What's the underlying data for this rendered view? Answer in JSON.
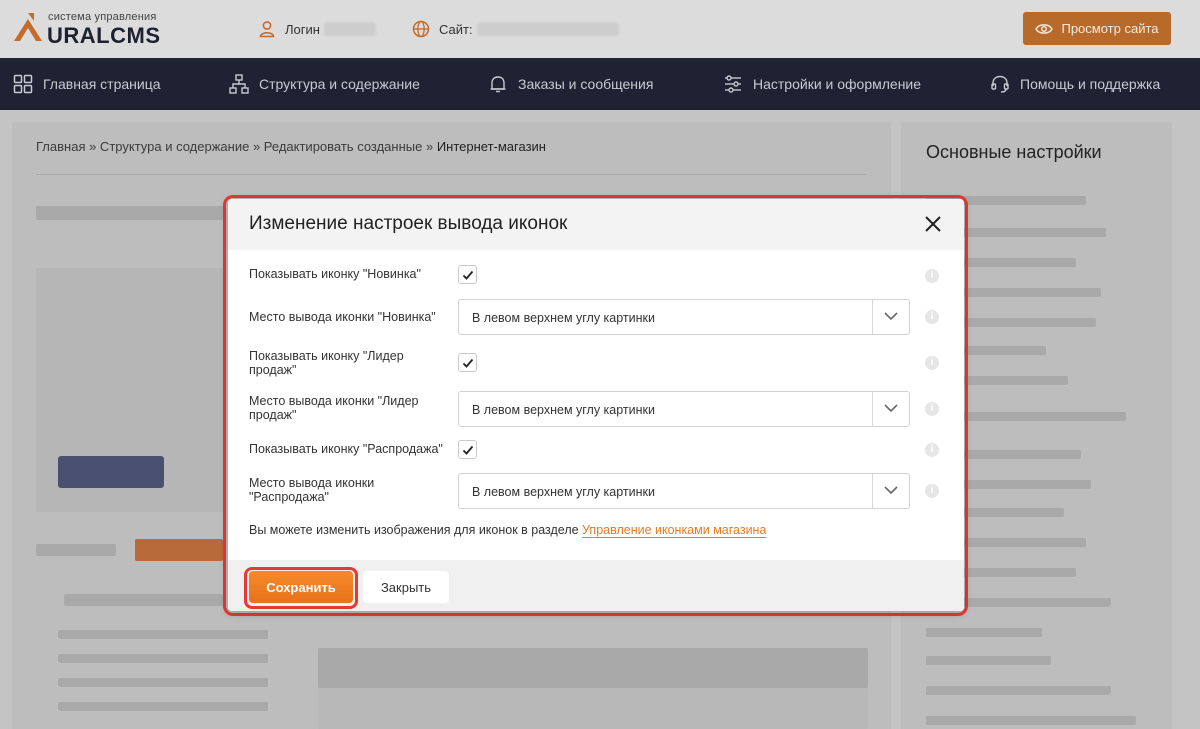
{
  "header": {
    "logo_sub": "система управления",
    "logo_name": "URALCMS",
    "login_label": "Логин",
    "site_label": "Сайт:",
    "view_site": "Просмотр сайта"
  },
  "nav": {
    "items": [
      {
        "label": "Главная страница",
        "icon": "grid-icon"
      },
      {
        "label": "Структура и содержание",
        "icon": "sitemap-icon"
      },
      {
        "label": "Заказы и сообщения",
        "icon": "bell-icon"
      },
      {
        "label": "Настройки и оформление",
        "icon": "sliders-icon"
      },
      {
        "label": "Помощь и поддержка",
        "icon": "headset-icon"
      }
    ]
  },
  "page": {
    "breadcrumb": "Главная » Структура и содержание » Редактировать созданные » ",
    "breadcrumb_current": "Интернет-магазин",
    "side_title": "Основные настройки"
  },
  "modal": {
    "title": "Изменение настроек вывода иконок",
    "rows": [
      {
        "label": "Показывать иконку \"Новинка\"",
        "checked": true
      },
      {
        "label": "Место вывода иконки \"Новинка\"",
        "value": "В левом верхнем углу картинки"
      },
      {
        "label": "Показывать иконку \"Лидер продаж\"",
        "checked": true
      },
      {
        "label": "Место вывода иконки \"Лидер продаж\"",
        "value": "В левом верхнем углу картинки"
      },
      {
        "label": "Показывать иконку \"Распродажа\"",
        "checked": true
      },
      {
        "label": "Место вывода иконки \"Распродажа\"",
        "value": "В левом верхнем углу картинки"
      }
    ],
    "note_text": "Вы можете изменить изображения для иконок в разделе ",
    "note_link": "Управление иконками магазина",
    "info_glyph": "i",
    "save_label": "Сохранить",
    "close_label": "Закрыть"
  },
  "colors": {
    "accent": "#f48a2c",
    "nav_bg": "#1f2233",
    "highlight": "#e53935"
  }
}
